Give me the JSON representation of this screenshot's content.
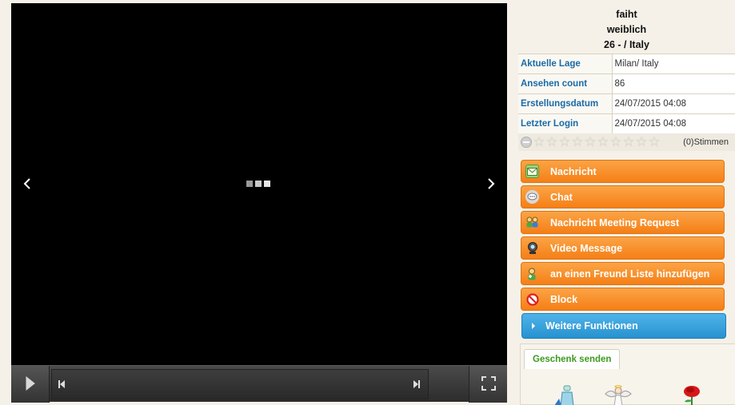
{
  "player": {
    "icons": {
      "prev": "chevron-left-icon",
      "next": "chevron-right-icon",
      "loader": "loading-dots-icon",
      "play": "play-icon",
      "skip_back": "skip-back-icon",
      "skip_forward": "skip-forward-icon",
      "fullscreen": "fullscreen-icon"
    }
  },
  "profile": {
    "name": "faiht",
    "gender": "weiblich",
    "age_location": "26 - / Italy"
  },
  "info": [
    {
      "label": "Aktuelle Lage",
      "value": "Milan/ Italy"
    },
    {
      "label": "Ansehen count",
      "value": "86"
    },
    {
      "label": "Erstellungsdatum",
      "value": "24/07/2015 04:08"
    },
    {
      "label": "Letzter Login",
      "value": "24/07/2015 04:08"
    }
  ],
  "rating": {
    "stars_total": 10,
    "stars_filled": 0,
    "votes_label": "(0)Stimmen"
  },
  "actions": [
    {
      "label": "Nachricht",
      "icon": "message-icon"
    },
    {
      "label": "Chat",
      "icon": "chat-icon"
    },
    {
      "label": "Nachricht Meeting Request",
      "icon": "meeting-icon"
    },
    {
      "label": "Video Message",
      "icon": "webcam-icon"
    },
    {
      "label": "an einen Freund Liste hinzufügen",
      "icon": "add-friend-icon"
    },
    {
      "label": "Block",
      "icon": "block-icon"
    }
  ],
  "more_functions": "Weitere Funktionen",
  "gifts": {
    "tab_label": "Geschenk senden",
    "items": [
      "perfume-gift-icon",
      "angel-gift-icon",
      "rose-gift-icon"
    ]
  },
  "colors": {
    "action_orange": "#f57f16",
    "more_blue": "#2792d0",
    "label_blue": "#1a6aa8",
    "gift_green": "#3e9a1e",
    "page_bg": "#f5f1e8"
  }
}
